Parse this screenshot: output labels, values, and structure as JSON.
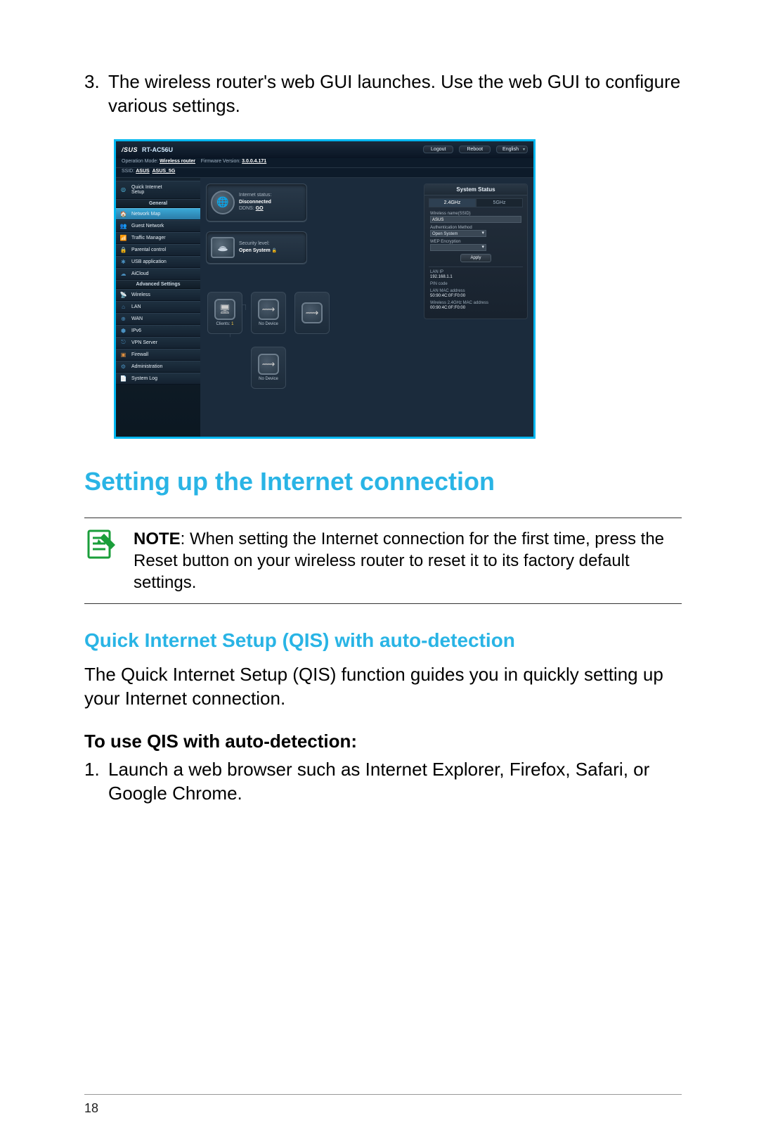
{
  "step3_num": "3.",
  "step3_text": "The wireless router's web GUI launches. Use the web GUI to configure various settings.",
  "router": {
    "brand": "/SUS",
    "model": "RT-AC56U",
    "btn_logout": "Logout",
    "btn_reboot": "Reboot",
    "lang": "English",
    "opmode_lbl": "Operation Mode:",
    "opmode_val": "Wireless router",
    "fw_lbl": "Firmware Version:",
    "fw_val": "3.0.0.4.171",
    "ssid_lbl": "SSID:",
    "ssid_val1": "ASUS",
    "ssid_val2": "ASUS_5G",
    "sb_qis1": "Quick Internet",
    "sb_qis2": "Setup",
    "sb_general": "General",
    "sb_netmap": "Network Map",
    "sb_guest": "Guest Network",
    "sb_traffic": "Traffic Manager",
    "sb_parental": "Parental control",
    "sb_usb": "USB application",
    "sb_aicloud": "AiCloud",
    "sb_adv": "Advanced Settings",
    "sb_wireless": "Wireless",
    "sb_lan": "LAN",
    "sb_wan": "WAN",
    "sb_ipv6": "IPv6",
    "sb_vpn": "VPN Server",
    "sb_firewall": "Firewall",
    "sb_admin": "Administration",
    "sb_syslog": "System Log",
    "internet_status_lbl": "Internet status:",
    "internet_status_val": "Disconnected",
    "ddns_lbl": "DDNS:",
    "ddns_val": "GO",
    "security_lbl": "Security level:",
    "security_val": "Open System",
    "clients_lbl": "Clients:",
    "clients_val": "1",
    "nodev": "No Device",
    "sp_title": "System Status",
    "tab24": "2.4GHz",
    "tab5": "5GHz",
    "wname_lbl": "Wireless name(SSID)",
    "wname_val": "ASUS",
    "auth_lbl": "Authentication Method",
    "auth_val": "Open System",
    "wep_lbl": "WEP Encryption",
    "apply": "Apply",
    "lanip_lbl": "LAN IP",
    "lanip_val": "192.168.1.1",
    "pin_lbl": "PIN code",
    "pin_val": "",
    "lanmac_lbl": "LAN MAC address",
    "lanmac_val": "50:90:4C:0F:F0:00",
    "wmac_lbl": "Wireless 2.4GHz MAC address",
    "wmac_val": "00:90:4C:0F:F0:00"
  },
  "heading1": "Setting up the Internet connection",
  "note_label": "NOTE",
  "note_text": ":     When setting the Internet connection for the first time, press the Reset button on your wireless router to reset it to its factory default settings.",
  "heading2": "Quick Internet Setup (QIS) with auto-detection",
  "para1": "The Quick Internet Setup (QIS) function guides you in quickly setting up your Internet connection.",
  "heading3": "To use QIS with auto-detection:",
  "qis_step1_num": "1.",
  "qis_step1_text": "Launch a web browser such as Internet Explorer, Firefox, Safari, or Google Chrome.",
  "page_number": "18"
}
